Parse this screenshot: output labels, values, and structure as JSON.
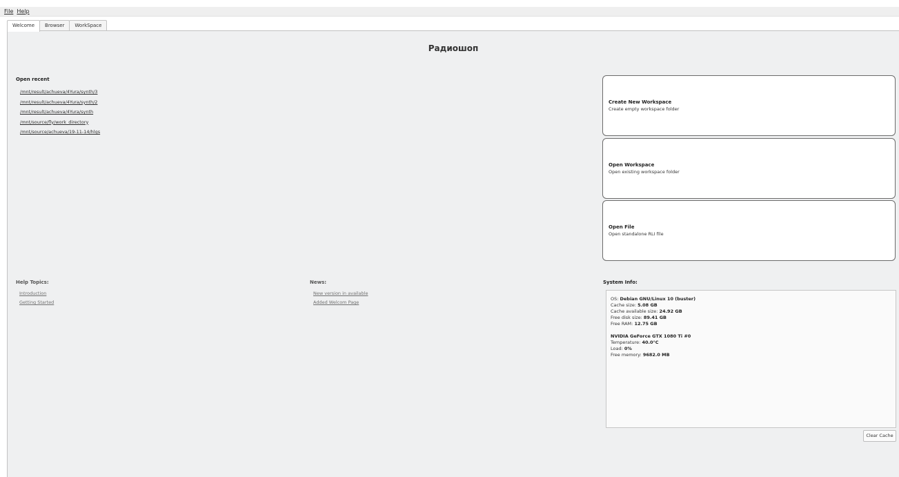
{
  "menu": [
    {
      "label": "File"
    },
    {
      "label": "Help"
    }
  ],
  "tabs": [
    {
      "label": "Welcome",
      "active": true
    },
    {
      "label": "Browser",
      "active": false
    },
    {
      "label": "WorkSpace",
      "active": false
    }
  ],
  "welcome": {
    "title": "Радиошоп",
    "open_recent": {
      "heading": "Open recent",
      "items": [
        "/mnt/result/achueva/4Yura/synth/3",
        "/mnt/result/achueva/4Yura/synth/2",
        "/mnt/result/achueva/4Yura/synth",
        "/mnt/source/fly/work_directory",
        "/mnt/source/achueva/19-11-14/hlgs"
      ]
    },
    "actions": [
      {
        "title": "Create New Workspace",
        "subtitle": "Create empty workspace folder"
      },
      {
        "title": "Open Workspace",
        "subtitle": "Open existing workspace folder"
      },
      {
        "title": "Open File",
        "subtitle": "Open standalone RLI file"
      }
    ],
    "help": {
      "heading": "Help Topics:",
      "items": [
        "Introduction",
        "Getting Started"
      ]
    },
    "news": {
      "heading": "News:",
      "items": [
        "New version in available",
        "Added Welcom Page"
      ]
    },
    "system": {
      "heading": "System Info:",
      "os_label": "OS: ",
      "os_value": "Debian GNU/Linux 10 (buster)",
      "cache_label": "Cache size: ",
      "cache_value": "5.08 GB",
      "cache_avail_label": "Cache available size: ",
      "cache_avail_value": "24.92 GB",
      "disk_label": "Free disk size: ",
      "disk_value": "89.41 GB",
      "ram_label": "Free RAM: ",
      "ram_value": "12.75 GB",
      "gpu_name": "NVIDIA GeForce GTX 1080 Ti #0",
      "temp_label": "Temperature: ",
      "temp_value": "40.0°C",
      "load_label": "Load: ",
      "load_value": "0%",
      "mem_label": "Free memory: ",
      "mem_value": "9682.0 MB"
    },
    "clear_cache": "Clear Cache"
  }
}
